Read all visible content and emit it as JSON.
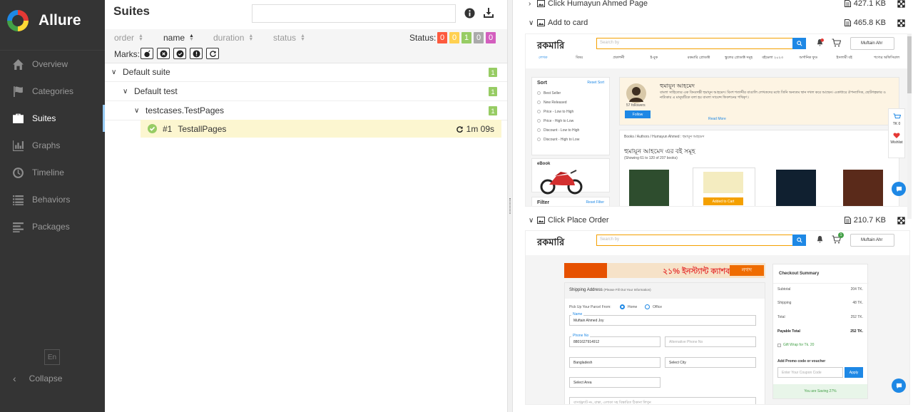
{
  "sidebar": {
    "brand": "Allure",
    "items": [
      {
        "label": "Overview",
        "icon": "home-icon"
      },
      {
        "label": "Categories",
        "icon": "flag-icon"
      },
      {
        "label": "Suites",
        "icon": "briefcase-icon",
        "active": true
      },
      {
        "label": "Graphs",
        "icon": "bar-chart-icon"
      },
      {
        "label": "Timeline",
        "icon": "clock-icon"
      },
      {
        "label": "Behaviors",
        "icon": "list-icon"
      },
      {
        "label": "Packages",
        "icon": "align-left-icon"
      }
    ],
    "language": "En",
    "collapse_label": "Collapse"
  },
  "main": {
    "title": "Suites",
    "search_placeholder": "",
    "sort": {
      "order": "order",
      "name": "name",
      "duration": "duration",
      "status": "status"
    },
    "status_label": "Status:",
    "status_counts": [
      {
        "value": "0",
        "color": "#fd5a3e"
      },
      {
        "value": "0",
        "color": "#ffd050"
      },
      {
        "value": "1",
        "color": "#97cc64"
      },
      {
        "value": "0",
        "color": "#aaaaaa"
      },
      {
        "value": "0",
        "color": "#d35ebe"
      }
    ],
    "marks_label": "Marks:",
    "tree": {
      "suite": {
        "label": "Default suite",
        "count": "1"
      },
      "test": {
        "label": "Default test",
        "count": "1"
      },
      "class": {
        "label": "testcases.TestPages",
        "count": "1"
      },
      "case": {
        "number": "#1",
        "name": "TestallPages",
        "duration": "1m 09s"
      }
    }
  },
  "attachments": [
    {
      "title": "Click Humayun Ahmed Page",
      "size": "427.1 KB",
      "expanded": false
    },
    {
      "title": "Add to card",
      "size": "465.8 KB",
      "expanded": true
    },
    {
      "title": "Click Place Order",
      "size": "210.7 KB",
      "expanded": true
    }
  ],
  "shot1": {
    "logo": "রকমারি",
    "search_placeholder": "Search by",
    "user": "Muftain Ahr",
    "menu": [
      "লেখক",
      "বিষয়",
      "প্রকাশনী",
      "ই-বুক",
      "রকমারি প্রোডাক্ট",
      "স্কুলের প্রোডাক্ট সমূহ",
      "বইমেলা ২০২৩",
      "অর্গানিক ফুড",
      "ইসলামী বই",
      "পণ্যের অফিসিয়াল"
    ],
    "sort_title": "Sort",
    "reset_sort": "Reset Sort",
    "sort_options": [
      "Best Seller",
      "New Released",
      "Price - Low to High",
      "Price - High to Low",
      "Discount - Low to High",
      "Discount - High to Low"
    ],
    "ebook_label": "eBook",
    "filter_title": "Filter",
    "reset_filter": "Reset Filter",
    "author_name": "হুমায়ূন আহমেদ",
    "followers": "57 followers",
    "follow_btn": "Follow",
    "bio": "বাংলা সাহিত্যের এক কিংবদন্তী হুমায়ূন আহমেদ। বিংশ শতাব্দীর বাঙালি লেখকদের মধ্যে তিনি অন্যতম স্থান দখল করে আছেন। একাধারে ঔপন্যাসিক, ছোটগল্পকার ও নাট্যকার এ মানুষটিকে বলা হয় বাংলা সায়েন্স ফিকশনের পথিকৃৎ।",
    "read_more": "Read More",
    "breadcrumb": "Books / Authors / Humayun Ahmed : হুমায়ূন আহমেদ",
    "books_heading": "হুমায়ূন আহমেদ এর বই সমূহ",
    "showing": "(Showing 61 to 120 of 207 books)",
    "added_to_cart": "Added to Cart",
    "cart_total": "TK 0",
    "wishlist": "Wishlist"
  },
  "shot2": {
    "logo": "রকমারি",
    "search_placeholder": "Search by",
    "user": "Muftain Ahr",
    "cart_badge": "1",
    "banner_text": "২১% ইনস্ট্যান্ট ক্যাশব্যাক",
    "banner_brand": "নগদ",
    "shipping_title": "Shipping Address",
    "shipping_hint": "(Please Fill Out Your Information)",
    "pickup_label": "Pick Up Your Parcel From:",
    "pickup_home": "Home",
    "pickup_office": "Office",
    "name_label": "Name",
    "name_value": "Muftain Ahmed Joy",
    "phone_label": "Phone No",
    "phone_value": "8801627914912",
    "alt_phone_placeholder": "Alternative Phone No",
    "country": "Bangladesh",
    "city": "Select City",
    "area": "Select Area",
    "address_hint": "বাসা/ফ্ল্যাট নং, রাস্তা, এলাকা সহ বিস্তারিত ঠিকানা লিখুন",
    "summary_title": "Checkout Summary",
    "summary": [
      {
        "label": "Subtotal",
        "value": "204 TK."
      },
      {
        "label": "Shipping",
        "value": "48 TK."
      },
      {
        "label": "Total",
        "value": "252 TK."
      },
      {
        "label": "Payable Total",
        "value": "252 TK."
      }
    ],
    "gift_wrap": "Gift Wrap for Tk. 20",
    "promo_title": "Add Promo code or voucher",
    "promo_placeholder": "Enter Your Coupon Code",
    "apply": "Apply",
    "saving": "You are Saving 27%"
  }
}
